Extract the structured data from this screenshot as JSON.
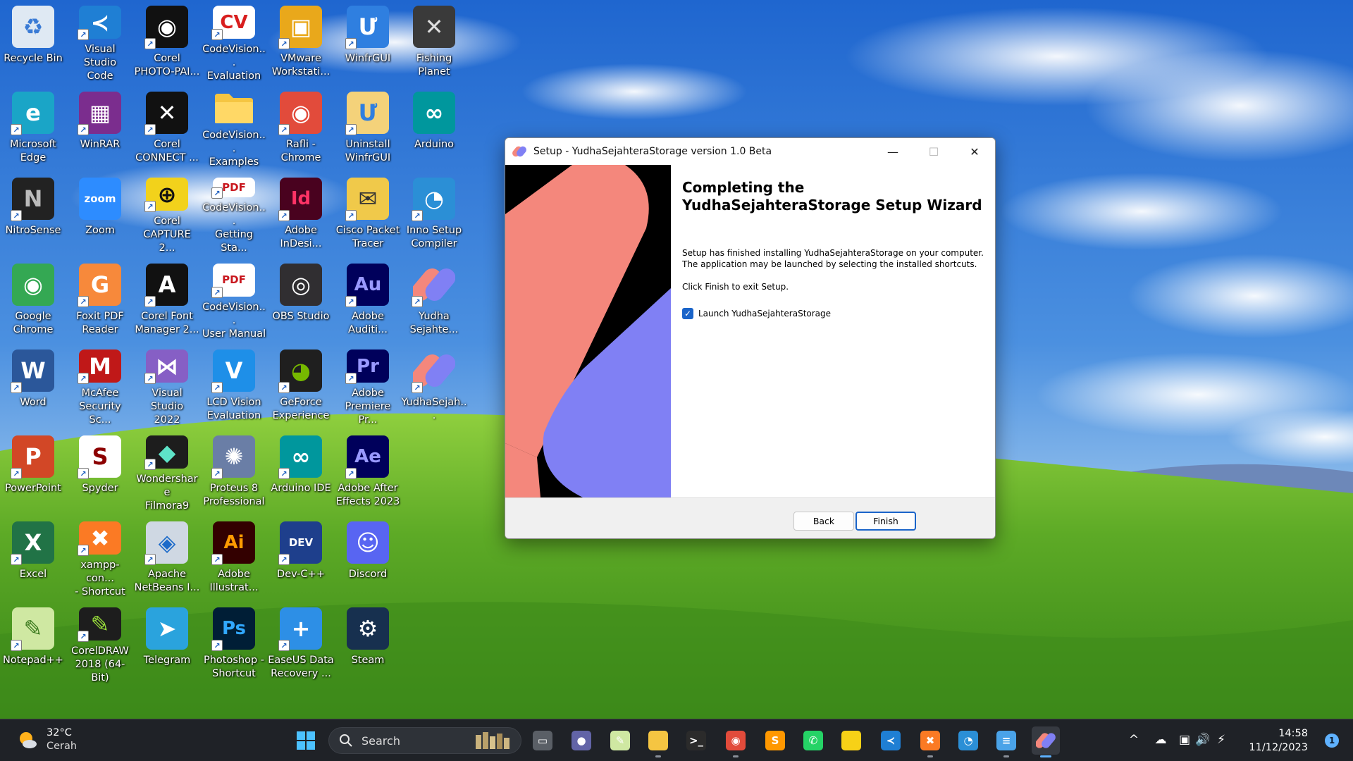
{
  "desktop_icons": [
    {
      "label": "Recycle Bin",
      "icon": "recycle-bin-icon",
      "abbr": "♻",
      "color": "#dfe9f3",
      "fg": "#3a7bd5",
      "shortcut": false
    },
    {
      "label": "Visual Studio\nCode",
      "icon": "vscode-icon",
      "abbr": "≺",
      "color": "#1f7fd4",
      "fg": "#fff",
      "shortcut": true
    },
    {
      "label": "Corel\nPHOTO-PAI...",
      "icon": "corel-photopaint-icon",
      "abbr": "◉",
      "color": "#111",
      "fg": "#fff",
      "shortcut": true
    },
    {
      "label": "CodeVision...\nEvaluation",
      "icon": "codevision-icon",
      "abbr": "CV",
      "color": "#ffffff",
      "fg": "#d81e1e",
      "shortcut": true
    },
    {
      "label": "VMware\nWorkstati...",
      "icon": "vmware-icon",
      "abbr": "▣",
      "color": "#e9a81b",
      "fg": "#fff",
      "shortcut": true
    },
    {
      "label": "WinfrGUI",
      "icon": "winfrgui-icon",
      "abbr": "Ư",
      "color": "#2f7fe0",
      "fg": "#fff",
      "shortcut": true
    },
    {
      "label": "Fishing Planet",
      "icon": "fishing-planet-icon",
      "abbr": "✕",
      "color": "#3a3a3a",
      "fg": "#ddd",
      "shortcut": false
    },
    {
      "label": "Microsoft\nEdge",
      "icon": "edge-icon",
      "abbr": "e",
      "color": "#1aa5c7",
      "fg": "#fff",
      "shortcut": true
    },
    {
      "label": "WinRAR",
      "icon": "winrar-icon",
      "abbr": "▦",
      "color": "#7b2d8e",
      "fg": "#fff",
      "shortcut": true
    },
    {
      "label": "Corel\nCONNECT ...",
      "icon": "corel-connect-icon",
      "abbr": "✕",
      "color": "#111",
      "fg": "#fff",
      "shortcut": true
    },
    {
      "label": "CodeVision...\nExamples",
      "icon": "folder-icon",
      "abbr": "",
      "color": "#f5c542",
      "fg": "#fff",
      "shortcut": false
    },
    {
      "label": "Rafli -\nChrome",
      "icon": "chrome-icon",
      "abbr": "◉",
      "color": "#e24b3b",
      "fg": "#fff",
      "shortcut": true
    },
    {
      "label": "Uninstall\nWinfrGUI",
      "icon": "uninstall-icon",
      "abbr": "Ư",
      "color": "#f4d27a",
      "fg": "#2f7fe0",
      "shortcut": true
    },
    {
      "label": "Arduino",
      "icon": "arduino-icon",
      "abbr": "∞",
      "color": "#00979d",
      "fg": "#fff",
      "shortcut": false
    },
    {
      "label": "NitroSense",
      "icon": "nitrosense-icon",
      "abbr": "N",
      "color": "#222",
      "fg": "#bbb",
      "shortcut": true
    },
    {
      "label": "Zoom",
      "icon": "zoom-icon",
      "abbr": "zoom",
      "color": "#2d8cff",
      "fg": "#fff",
      "shortcut": false
    },
    {
      "label": "Corel\nCAPTURE 2...",
      "icon": "corel-capture-icon",
      "abbr": "⊕",
      "color": "#f2d21b",
      "fg": "#111",
      "shortcut": true
    },
    {
      "label": "CodeVision...\nGetting Sta...",
      "icon": "pdf-icon",
      "abbr": "PDF",
      "color": "#ffffff",
      "fg": "#c8171e",
      "shortcut": true
    },
    {
      "label": "Adobe\nInDesi...",
      "icon": "indesign-icon",
      "abbr": "Id",
      "color": "#49021f",
      "fg": "#ff3366",
      "shortcut": true
    },
    {
      "label": "Cisco Packet\nTracer",
      "icon": "cisco-packet-tracer-icon",
      "abbr": "✉",
      "color": "#f0c94a",
      "fg": "#333",
      "shortcut": true
    },
    {
      "label": "Inno Setup\nCompiler",
      "icon": "inno-setup-icon",
      "abbr": "◔",
      "color": "#2b8fd6",
      "fg": "#fff",
      "shortcut": true
    },
    {
      "label": "Google\nChrome",
      "icon": "chrome-icon",
      "abbr": "◉",
      "color": "#34a853",
      "fg": "#fff",
      "shortcut": false
    },
    {
      "label": "Foxit PDF\nReader",
      "icon": "foxit-icon",
      "abbr": "G",
      "color": "#f7893b",
      "fg": "#fff",
      "shortcut": true
    },
    {
      "label": "Corel Font\nManager 2...",
      "icon": "corel-font-icon",
      "abbr": "A",
      "color": "#111",
      "fg": "#fff",
      "shortcut": true
    },
    {
      "label": "CodeVision...\nUser Manual",
      "icon": "pdf-icon",
      "abbr": "PDF",
      "color": "#ffffff",
      "fg": "#c8171e",
      "shortcut": true
    },
    {
      "label": "OBS Studio",
      "icon": "obs-icon",
      "abbr": "◎",
      "color": "#302e31",
      "fg": "#fff",
      "shortcut": false
    },
    {
      "label": "Adobe\nAuditi...",
      "icon": "audition-icon",
      "abbr": "Au",
      "color": "#00005b",
      "fg": "#9999ff",
      "shortcut": true
    },
    {
      "label": "Yudha\nSejahte...",
      "icon": "yudha-app-icon",
      "abbr": "",
      "color": "transparent",
      "fg": "#fff",
      "shortcut": true
    },
    {
      "label": "Word",
      "icon": "word-icon",
      "abbr": "W",
      "color": "#2b579a",
      "fg": "#fff",
      "shortcut": true
    },
    {
      "label": "McAfee\nSecurity Sc...",
      "icon": "mcafee-icon",
      "abbr": "M",
      "color": "#c01818",
      "fg": "#fff",
      "shortcut": true
    },
    {
      "label": "Visual Studio\n2022",
      "icon": "visual-studio-icon",
      "abbr": "⋈",
      "color": "#865fc5",
      "fg": "#fff",
      "shortcut": true
    },
    {
      "label": "LCD Vision\nEvaluation",
      "icon": "lcd-vision-icon",
      "abbr": "V",
      "color": "#1e8fe8",
      "fg": "#fff",
      "shortcut": true
    },
    {
      "label": "GeForce\nExperience",
      "icon": "geforce-icon",
      "abbr": "◕",
      "color": "#1f1f1f",
      "fg": "#76b900",
      "shortcut": true
    },
    {
      "label": "Adobe\nPremiere Pr...",
      "icon": "premiere-icon",
      "abbr": "Pr",
      "color": "#00005b",
      "fg": "#9999ff",
      "shortcut": true
    },
    {
      "label": "YudhaSejah...",
      "icon": "yudha-app-icon",
      "abbr": "",
      "color": "transparent",
      "fg": "#fff",
      "shortcut": true
    },
    {
      "label": "PowerPoint",
      "icon": "powerpoint-icon",
      "abbr": "P",
      "color": "#d24726",
      "fg": "#fff",
      "shortcut": true
    },
    {
      "label": "Spyder",
      "icon": "spyder-icon",
      "abbr": "S",
      "color": "#ffffff",
      "fg": "#8c0000",
      "shortcut": true
    },
    {
      "label": "Wondershare\nFilmora9",
      "icon": "filmora-icon",
      "abbr": "◆",
      "color": "#1d1d1d",
      "fg": "#5ee3c8",
      "shortcut": true
    },
    {
      "label": "Proteus 8\nProfessional",
      "icon": "proteus-icon",
      "abbr": "✺",
      "color": "#6a7ea6",
      "fg": "#fff",
      "shortcut": true
    },
    {
      "label": "Arduino IDE",
      "icon": "arduino-icon",
      "abbr": "∞",
      "color": "#00979d",
      "fg": "#fff",
      "shortcut": true
    },
    {
      "label": "Adobe After\nEffects 2023",
      "icon": "after-effects-icon",
      "abbr": "Ae",
      "color": "#00005b",
      "fg": "#9999ff",
      "shortcut": true
    },
    {
      "label": "Excel",
      "icon": "excel-icon",
      "abbr": "X",
      "color": "#217346",
      "fg": "#fff",
      "shortcut": true
    },
    {
      "label": "xampp-con...\n- Shortcut",
      "icon": "xampp-icon",
      "abbr": "✖",
      "color": "#fb7a24",
      "fg": "#fff",
      "shortcut": true
    },
    {
      "label": "Apache\nNetBeans I...",
      "icon": "netbeans-icon",
      "abbr": "◈",
      "color": "#cfd8e3",
      "fg": "#1b6ac9",
      "shortcut": true
    },
    {
      "label": "Adobe\nIllustrat...",
      "icon": "illustrator-icon",
      "abbr": "Ai",
      "color": "#330000",
      "fg": "#ff9a00",
      "shortcut": true
    },
    {
      "label": "Dev-C++",
      "icon": "devcpp-icon",
      "abbr": "DEV",
      "color": "#1e3f8c",
      "fg": "#fff",
      "shortcut": true
    },
    {
      "label": "Discord",
      "icon": "discord-icon",
      "abbr": "☺",
      "color": "#5865f2",
      "fg": "#fff",
      "shortcut": false
    },
    {
      "label": "Notepad++",
      "icon": "notepadpp-icon",
      "abbr": "✎",
      "color": "#cfe8a2",
      "fg": "#3c7a1f",
      "shortcut": true
    },
    {
      "label": "CorelDRAW\n2018 (64-Bit)",
      "icon": "coreldraw-icon",
      "abbr": "✎",
      "color": "#1d1d1d",
      "fg": "#9adf3b",
      "shortcut": true
    },
    {
      "label": "Telegram",
      "icon": "telegram-icon",
      "abbr": "➤",
      "color": "#2aa3dd",
      "fg": "#fff",
      "shortcut": false
    },
    {
      "label": "Photoshop -\nShortcut",
      "icon": "photoshop-icon",
      "abbr": "Ps",
      "color": "#001e36",
      "fg": "#31a8ff",
      "shortcut": true
    },
    {
      "label": "EaseUS Data\nRecovery ...",
      "icon": "easeus-icon",
      "abbr": "+",
      "color": "#2d8fe6",
      "fg": "#fff",
      "shortcut": true
    },
    {
      "label": "Steam",
      "icon": "steam-icon",
      "abbr": "⚙",
      "color": "#17304f",
      "fg": "#fff",
      "shortcut": false
    }
  ],
  "setup_window": {
    "title": "Setup - YudhaSejahteraStorage version 1.0 Beta",
    "minimize": "—",
    "maximize": "☐",
    "close": "✕",
    "heading": "Completing the\nYudhaSejahteraStorage Setup Wizard",
    "paragraph1": "Setup has finished installing YudhaSejahteraStorage on your computer.\nThe application may be launched by selecting the installed shortcuts.",
    "paragraph2": "Click Finish to exit Setup.",
    "launch_checkbox_label": "Launch YudhaSejahteraStorage",
    "launch_checked": true,
    "back_label": "Back",
    "finish_label": "Finish",
    "image_colors": {
      "pink": "#f4877c",
      "purple": "#8080f4",
      "background": "#000000"
    }
  },
  "taskbar": {
    "weather_temp": "32°C",
    "weather_condition": "Cerah",
    "search_placeholder": "Search",
    "apps": [
      {
        "name": "start-button",
        "icon": "windows-start-icon",
        "abbr": "",
        "color": "#3aa0ff",
        "running": false,
        "active": false
      },
      {
        "name": "task-view-button",
        "icon": "task-view-icon",
        "abbr": "▭",
        "color": "#5a5f66",
        "running": false,
        "active": false
      },
      {
        "name": "teams-meet-button",
        "icon": "meet-camera-icon",
        "abbr": "●",
        "color": "#6264a7",
        "running": false,
        "active": false
      },
      {
        "name": "notepadpp-taskbar",
        "icon": "notepadpp-icon",
        "abbr": "✎",
        "color": "#cfe8a2",
        "running": false,
        "active": false
      },
      {
        "name": "file-explorer-taskbar",
        "icon": "folder-icon",
        "abbr": "",
        "color": "#f5c542",
        "running": true,
        "active": false
      },
      {
        "name": "terminal-taskbar",
        "icon": "terminal-icon",
        "abbr": ">_",
        "color": "#2b2b2b",
        "running": false,
        "active": false
      },
      {
        "name": "chrome-taskbar",
        "icon": "chrome-icon",
        "abbr": "◉",
        "color": "#e24b3b",
        "running": true,
        "active": false
      },
      {
        "name": "sublime-taskbar",
        "icon": "sublime-text-icon",
        "abbr": "S",
        "color": "#ff9800",
        "running": false,
        "active": false
      },
      {
        "name": "whatsapp-taskbar",
        "icon": "whatsapp-icon",
        "abbr": "✆",
        "color": "#25d366",
        "running": false,
        "active": false
      },
      {
        "name": "sticky-notes-taskbar",
        "icon": "sticky-notes-icon",
        "abbr": "",
        "color": "#f7d117",
        "running": false,
        "active": false
      },
      {
        "name": "vscode-taskbar",
        "icon": "vscode-icon",
        "abbr": "≺",
        "color": "#1f7fd4",
        "running": false,
        "active": false
      },
      {
        "name": "xampp-taskbar",
        "icon": "xampp-icon",
        "abbr": "✖",
        "color": "#fb7a24",
        "running": true,
        "active": false
      },
      {
        "name": "inno-setup-taskbar",
        "icon": "inno-setup-icon",
        "abbr": "◔",
        "color": "#2b8fd6",
        "running": false,
        "active": false
      },
      {
        "name": "notepad-taskbar",
        "icon": "notepad-icon",
        "abbr": "≡",
        "color": "#4aa3e8",
        "running": true,
        "active": false
      },
      {
        "name": "yudha-setup-taskbar",
        "icon": "yudha-app-icon",
        "abbr": "",
        "color": "transparent",
        "running": true,
        "active": true
      }
    ],
    "tray": {
      "chevron": "^",
      "cloud": "☁",
      "network": "▣",
      "volume": "🔊",
      "battery": "⚡"
    },
    "time": "14:58",
    "date": "11/12/2023",
    "notification_count": "1"
  }
}
